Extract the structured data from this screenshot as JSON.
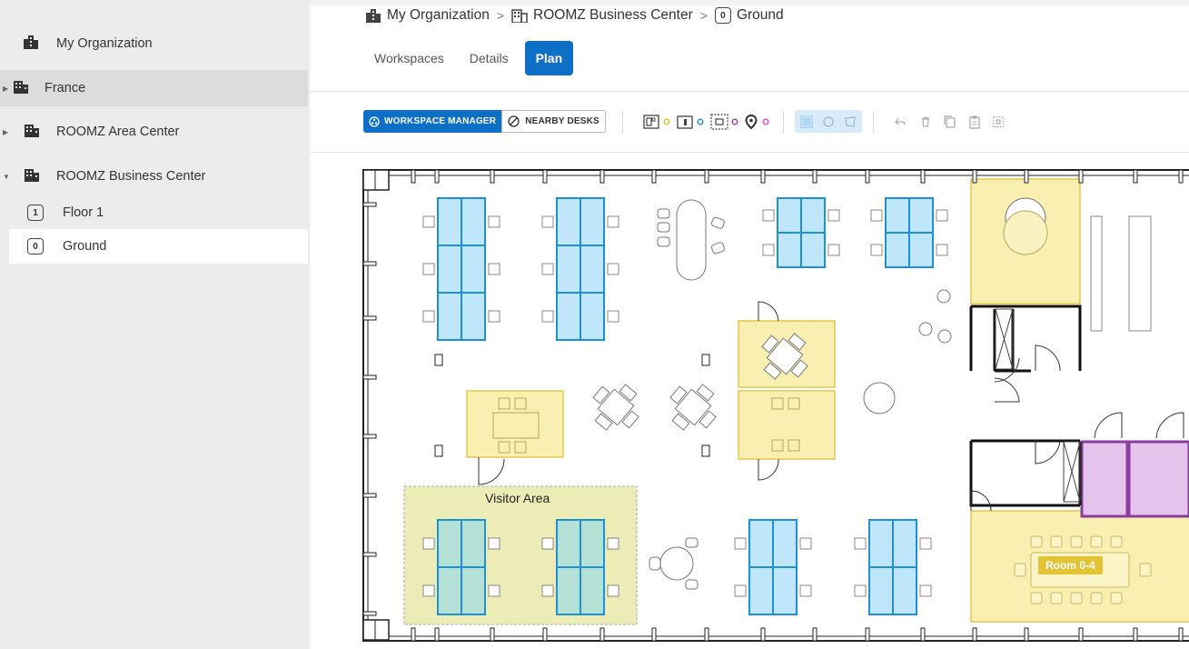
{
  "sidebar": {
    "items": [
      {
        "label": "My Organization"
      },
      {
        "label": "France"
      },
      {
        "label": "ROOMZ Area Center"
      },
      {
        "label": "ROOMZ Business Center"
      },
      {
        "label": "Floor 1",
        "badge": "1"
      },
      {
        "label": "Ground",
        "badge": "0"
      }
    ]
  },
  "breadcrumb": {
    "org": "My Organization",
    "building": "ROOMZ Business Center",
    "floor_badge": "0",
    "floor": "Ground",
    "separator": ">"
  },
  "tabs": {
    "workspaces": "Workspaces",
    "details": "Details",
    "plan": "Plan"
  },
  "toolbar": {
    "workspace_manager": "WORKSPACE MANAGER",
    "nearby_desks": "NEARBY DESKS"
  },
  "plan": {
    "visitor_area_label": "Visitor Area",
    "room_label": "Room 0-4"
  },
  "colors": {
    "accent": "#0d6fc6",
    "desk_fill": "#bfe6fb",
    "desk_stroke": "#1e90d6",
    "room_fill": "#f8efb1",
    "room_stroke": "#e3c94d",
    "private_room_fill": "#e4c4ec",
    "private_room_stroke": "#8a3c9c",
    "visitor_area_fill": "#ecedb6"
  }
}
